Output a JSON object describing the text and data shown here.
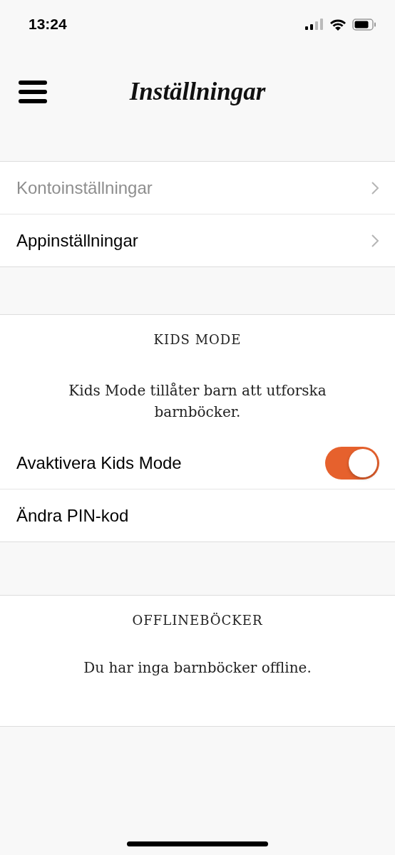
{
  "status_bar": {
    "time": "13:24"
  },
  "header": {
    "title": "Inställningar"
  },
  "menu_rows": [
    {
      "label": "Kontoinställningar",
      "disabled": true
    },
    {
      "label": "Appinställningar",
      "disabled": false
    }
  ],
  "kids_mode": {
    "heading": "KIDS MODE",
    "description": "Kids Mode tillåter barn att utforska barnböcker.",
    "toggle": {
      "label": "Avaktivera Kids Mode",
      "on": true
    },
    "pin_row": {
      "label": "Ändra PIN-kod"
    }
  },
  "offline": {
    "heading": "OFFLINEBÖCKER",
    "message": "Du har inga barnböcker offline."
  }
}
